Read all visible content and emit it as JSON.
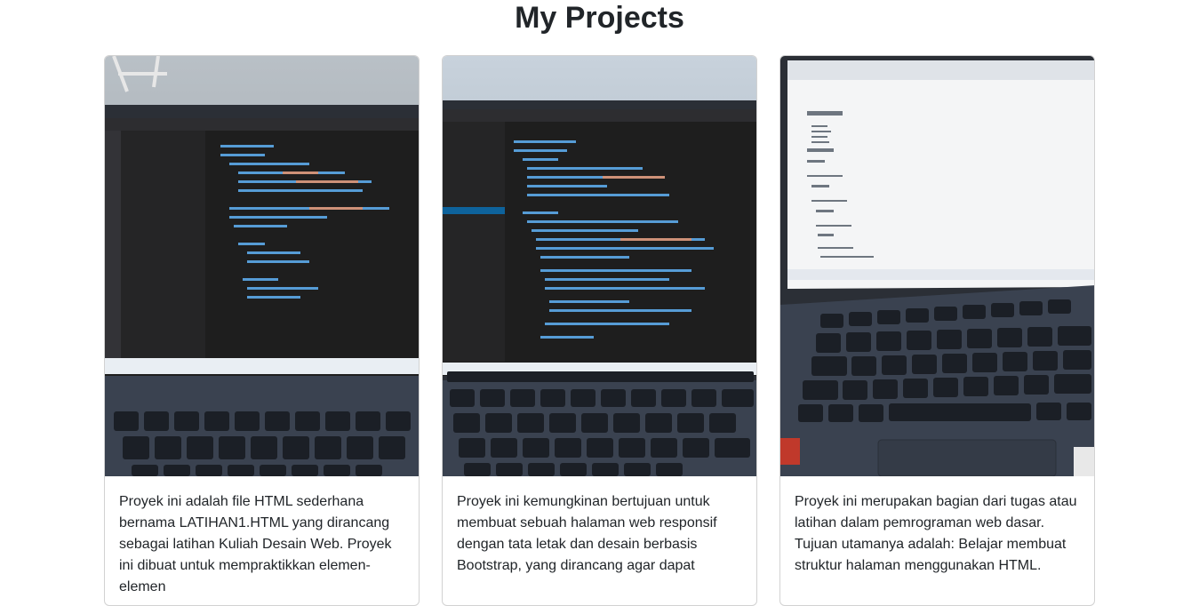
{
  "page": {
    "title": "My Projects"
  },
  "projects": [
    {
      "image_icon": "laptop-photo",
      "description": "Proyek ini adalah file HTML sederhana bernama LATIHAN1.HTML yang dirancang sebagai latihan Kuliah Desain Web. Proyek ini dibuat untuk mempraktikkan elemen-elemen"
    },
    {
      "image_icon": "laptop-photo",
      "description": "Proyek ini kemungkinan bertujuan untuk membuat sebuah halaman web responsif dengan tata letak dan desain berbasis Bootstrap, yang dirancang agar dapat"
    },
    {
      "image_icon": "laptop-photo",
      "description": "Proyek ini merupakan bagian dari tugas atau latihan dalam pemrograman web dasar. Tujuan utamanya adalah: Belajar membuat struktur halaman menggunakan HTML."
    }
  ],
  "colors": {
    "text": "#212529",
    "card_border": "#d9d9d9",
    "editor_bg": "#1e1e1e",
    "laptop_body": "#3a4250",
    "key": "#1b1f26"
  }
}
